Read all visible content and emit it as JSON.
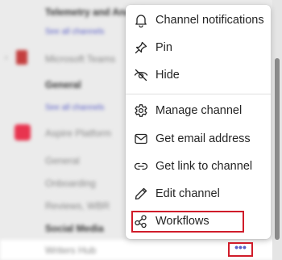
{
  "background_list": {
    "rows": [
      {
        "text": "Telemetry and Analytics",
        "style": "bold"
      },
      {
        "text": "See all channels",
        "style": "link"
      },
      {
        "text": "Microsoft Teams",
        "style": "team"
      },
      {
        "text": "General",
        "style": "bold"
      },
      {
        "text": "See all channels",
        "style": "link"
      },
      {
        "text": "Aspire Platform",
        "style": "team"
      },
      {
        "text": "General",
        "style": "muted"
      },
      {
        "text": "Onboarding",
        "style": "muted"
      },
      {
        "text": "Reviews, WBR",
        "style": "muted"
      },
      {
        "text": "Social Media",
        "style": "bold"
      },
      {
        "text": "Writers Hub",
        "style": "muted"
      }
    ]
  },
  "context_menu": {
    "items": [
      {
        "label": "Channel notifications",
        "icon": "bell-icon"
      },
      {
        "label": "Pin",
        "icon": "pin-icon"
      },
      {
        "label": "Hide",
        "icon": "eye-off-icon"
      },
      {
        "label": "Manage channel",
        "icon": "gear-icon"
      },
      {
        "label": "Get email address",
        "icon": "mail-icon"
      },
      {
        "label": "Get link to channel",
        "icon": "link-icon"
      },
      {
        "label": "Edit channel",
        "icon": "pencil-icon"
      },
      {
        "label": "Workflows",
        "icon": "workflows-icon"
      }
    ]
  },
  "more_options": {
    "label": "•••",
    "icon": "more-options-icon"
  },
  "colors": {
    "accent": "#5b5fc7",
    "highlight_border": "#d01c2a",
    "menu_text": "#242424"
  }
}
